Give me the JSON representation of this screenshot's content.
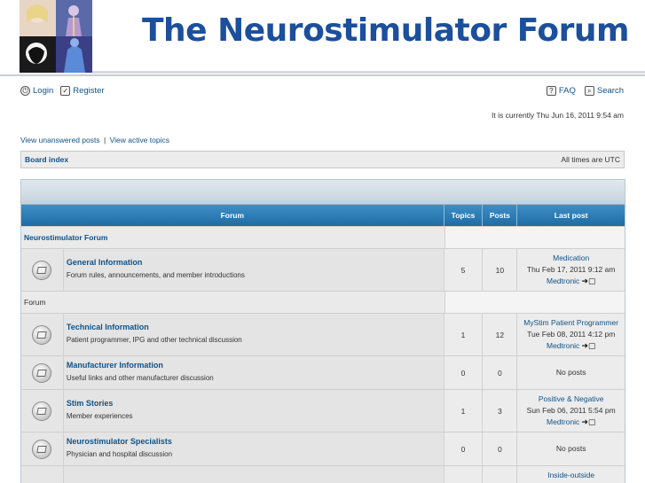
{
  "header": {
    "title": "The Neurostimulator Forum"
  },
  "nav": {
    "login": "Login",
    "register": "Register",
    "faq": "FAQ",
    "search": "Search"
  },
  "current_time": "It is currently Thu Jun 16, 2011 9:54 am",
  "quick_links": {
    "unanswered": "View unanswered posts",
    "separator": "|",
    "active": "View active topics"
  },
  "breadcrumb": {
    "board_index": "Board index",
    "timezone": "All times are UTC"
  },
  "table": {
    "columns": {
      "forum": "Forum",
      "topics": "Topics",
      "posts": "Posts",
      "last_post": "Last post"
    },
    "categories": [
      {
        "title": "Neurostimulator Forum"
      },
      {
        "title": "Forum"
      }
    ],
    "forums": [
      {
        "title": "General Information",
        "description": "Forum rules, announcements, and member introductions",
        "topics": "5",
        "posts": "10",
        "last_topic": "Medication",
        "last_date": "Thu Feb 17, 2011 9:12 am",
        "last_user": "Medtronic",
        "no_posts": ""
      },
      {
        "title": "Technical Information",
        "description": "Patient programmer, IPG and other technical discussion",
        "topics": "1",
        "posts": "12",
        "last_topic": "MyStim Patient Programmer",
        "last_date": "Tue Feb 08, 2011 4:12 pm",
        "last_user": "Medtronic",
        "no_posts": ""
      },
      {
        "title": "Manufacturer Information",
        "description": "Useful links and other manufacturer discussion",
        "topics": "0",
        "posts": "0",
        "last_topic": "",
        "last_date": "",
        "last_user": "",
        "no_posts": "No posts"
      },
      {
        "title": "Stim Stories",
        "description": "Member experiences",
        "topics": "1",
        "posts": "3",
        "last_topic": "Positive & Negative",
        "last_date": "Sun Feb 06, 2011 5:54 pm",
        "last_user": "Medtronic",
        "no_posts": ""
      },
      {
        "title": "Neurostimulator Specialists",
        "description": "Physician and hospital discussion",
        "topics": "0",
        "posts": "0",
        "last_topic": "",
        "last_date": "",
        "last_user": "",
        "no_posts": "No posts"
      },
      {
        "title": "",
        "description": "",
        "topics": "",
        "posts": "",
        "last_topic": "Inside-outside",
        "last_date": "",
        "last_user": "",
        "no_posts": ""
      }
    ],
    "goto_glyph": "➜▢"
  },
  "colors": {
    "title_blue": "#1c4f9c",
    "link_blue": "#105289",
    "header_blue": "#1e6ca5"
  }
}
